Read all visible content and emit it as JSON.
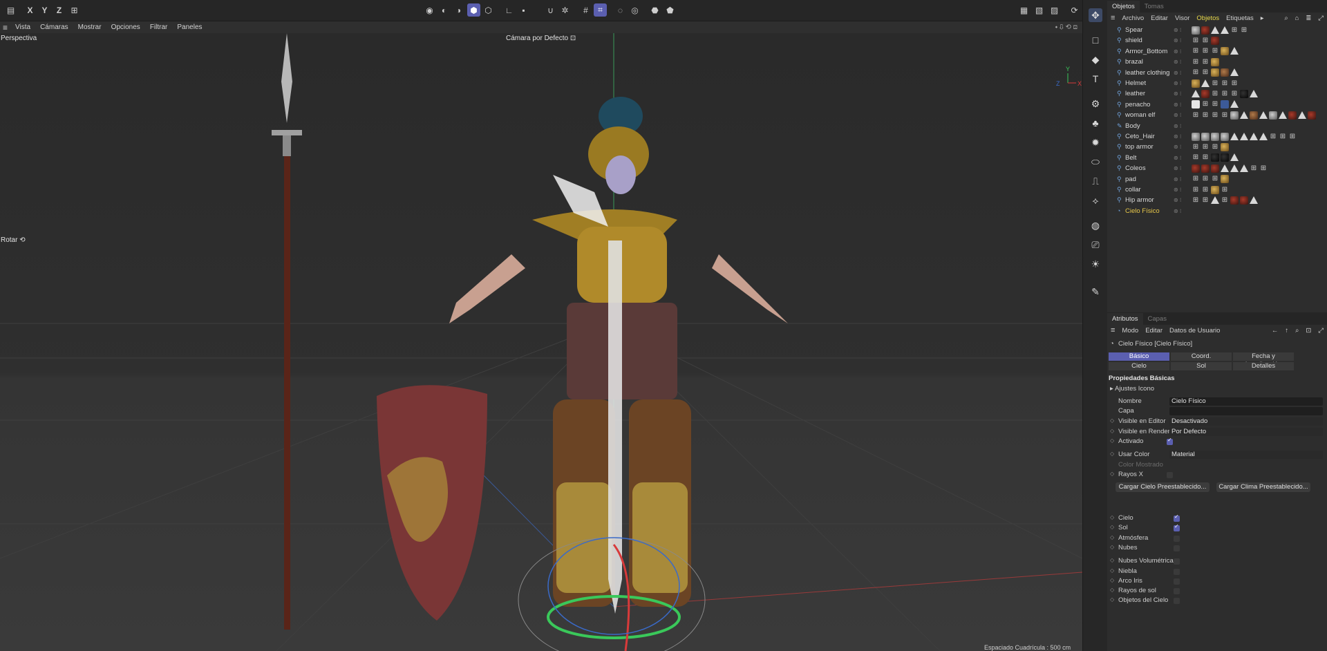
{
  "toolbar": {
    "axes": [
      "X",
      "Y",
      "Z"
    ]
  },
  "menubar": [
    "Vista",
    "Cámaras",
    "Mostrar",
    "Opciones",
    "Filtrar",
    "Paneles"
  ],
  "viewport": {
    "label": "Perspectiva",
    "camera": "Cámara por Defecto",
    "mode": "Rotar",
    "grid_info": "Espaciado Cuadrícula : 500 cm"
  },
  "objects_panel": {
    "tabs": [
      "Objetos",
      "Tomas"
    ],
    "menu": [
      "Archivo",
      "Editar",
      "Visor",
      "Objetos",
      "Etiquetas"
    ],
    "items": [
      {
        "name": "Spear",
        "tags": [
          "gr",
          "rd",
          "tri",
          "tri",
          "stk",
          "stk"
        ]
      },
      {
        "name": "shield",
        "tags": [
          "stk",
          "stk",
          "rd"
        ]
      },
      {
        "name": "Armor_Bottom",
        "tags": [
          "stk",
          "stk",
          "stk",
          "gd",
          "tri"
        ]
      },
      {
        "name": "brazal",
        "tags": [
          "stk",
          "stk",
          "gd"
        ]
      },
      {
        "name": "leather clothing",
        "tags": [
          "stk",
          "stk",
          "gd",
          "br",
          "tri"
        ]
      },
      {
        "name": "Helmet",
        "tags": [
          "gd",
          "tri",
          "stk",
          "stk",
          "stk"
        ]
      },
      {
        "name": "leather",
        "tags": [
          "tri",
          "rd",
          "stk",
          "stk",
          "stk",
          "dk",
          "tri"
        ]
      },
      {
        "name": "penacho",
        "tags": [
          "wh",
          "stk",
          "stk",
          "bl",
          "tri"
        ]
      },
      {
        "name": "woman elf",
        "tags": [
          "stk",
          "stk",
          "stk",
          "stk",
          "gr",
          "tri",
          "br",
          "tri",
          "gr",
          "tri",
          "rd",
          "tri",
          "rd"
        ]
      },
      {
        "name": "Body",
        "tags": []
      },
      {
        "name": "Ceto_Hair",
        "tags": [
          "gr",
          "gr",
          "gr",
          "gr",
          "tri",
          "tri",
          "tri",
          "tri",
          "stk",
          "stk",
          "stk"
        ]
      },
      {
        "name": "top armor",
        "tags": [
          "stk",
          "stk",
          "stk",
          "gd"
        ]
      },
      {
        "name": "Belt",
        "tags": [
          "stk",
          "stk",
          "dk",
          "dk",
          "tri"
        ]
      },
      {
        "name": "Coleos",
        "tags": [
          "rd",
          "rd",
          "rd",
          "tri",
          "tri",
          "tri",
          "stk",
          "stk"
        ]
      },
      {
        "name": "pad",
        "tags": [
          "stk",
          "stk",
          "stk",
          "gd"
        ]
      },
      {
        "name": "collar",
        "tags": [
          "stk",
          "stk",
          "gd",
          "stk"
        ]
      },
      {
        "name": "Hip armor",
        "tags": [
          "stk",
          "stk",
          "tri",
          "stk",
          "rd",
          "rd",
          "tri"
        ]
      },
      {
        "name": "Cielo Físico",
        "tags": []
      }
    ]
  },
  "attributes": {
    "tabs": [
      "Atributos",
      "Capas"
    ],
    "menu": [
      "Modo",
      "Editar",
      "Datos de Usuario"
    ],
    "object_title": "Cielo Físico [Cielo Físico]",
    "segments_row1": [
      "Básico",
      "Coord.",
      "Fecha y Localización"
    ],
    "segments_row2": [
      "Cielo",
      "Sol",
      "Detalles"
    ],
    "section": "Propiedades Básicas",
    "subsection": "Ajustes Icono",
    "fields": {
      "nombre_label": "Nombre",
      "nombre_value": "Cielo Físico",
      "capa_label": "Capa",
      "visible_editor_label": "Visible en Editor",
      "visible_editor_value": "Desactivado",
      "visible_render_label": "Visible en Render",
      "visible_render_value": "Por Defecto",
      "activado_label": "Activado",
      "usar_color_label": "Usar Color",
      "usar_color_value": "Material",
      "color_mostrado_label": "Color Mostrado",
      "rayos_x_label": "Rayos X"
    },
    "buttons": [
      "Cargar Cielo Preestablecido...",
      "Cargar Clima Preestablecido..."
    ],
    "checks": [
      {
        "label": "Cielo",
        "on": true
      },
      {
        "label": "Sol",
        "on": true
      },
      {
        "label": "Atmósfera",
        "on": false
      },
      {
        "label": "Nubes",
        "on": false
      },
      {
        "label": "Nubes Volumétricas",
        "on": false
      },
      {
        "label": "Niebla",
        "on": false
      },
      {
        "label": "Arco Iris",
        "on": false
      },
      {
        "label": "Rayos de sol",
        "on": false
      },
      {
        "label": "Objetos del Cielo",
        "on": false
      }
    ]
  },
  "colors": {
    "accent": "#5b5fb0",
    "highlight": "#e8d84a",
    "active_object": "#e8c84a"
  }
}
